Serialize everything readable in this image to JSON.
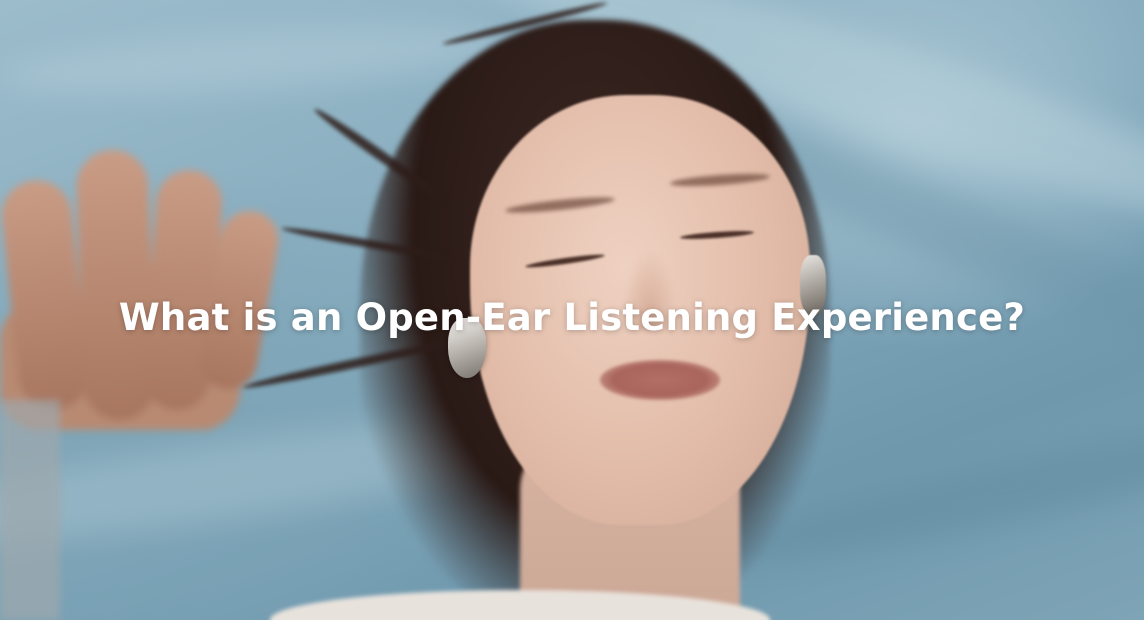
{
  "hero": {
    "headline": "What is an Open-Ear Listening Experience?",
    "background_image": "woman-wearing-open-ear-earbuds-eyes-closed"
  },
  "colors": {
    "headline_text": "#ffffff",
    "sky_blue": "#84aabd"
  }
}
